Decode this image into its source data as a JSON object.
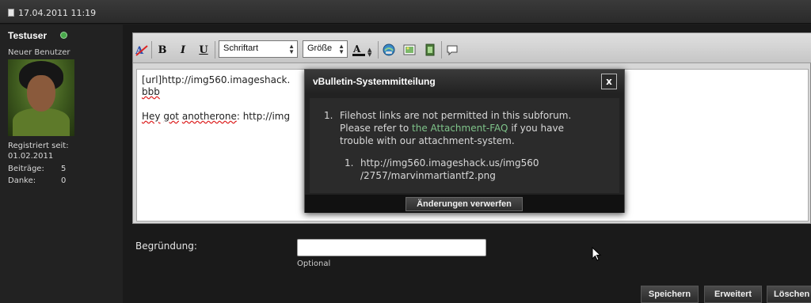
{
  "post": {
    "date": "17.04.2011 11:19"
  },
  "user": {
    "name": "Testuser",
    "title": "Neuer Benutzer",
    "registered_label": "Registriert seit:",
    "registered_date": "01.02.2011",
    "posts_label": "Beiträge:",
    "posts_value": "5",
    "thanks_label": "Danke:",
    "thanks_value": "0"
  },
  "toolbar": {
    "font_select": "Schriftart",
    "size_select": "Größe",
    "bold": "B",
    "italic": "I",
    "underline": "U"
  },
  "editor": {
    "line1": "[url]http://img560.imageshack.",
    "line2": "bbb",
    "line3_prefix": "Hey",
    "line3_word1": "got",
    "line3_word2": "anotherone",
    "line3_rest": ": http://img"
  },
  "modal": {
    "title": "vBulletin-Systemmitteilung",
    "close": "x",
    "item_number": "1.",
    "message_1": "Filehost links are not permitted in this subforum.",
    "message_2_before": "Please refer to",
    "message_2_link": "the Attachment-FAQ",
    "message_2_after": "if you have",
    "message_3": "trouble with our attachment-system.",
    "sub_number": "1.",
    "url_line1": "http://img560.imageshack.us/img560",
    "url_line2": "/2757/marvinmartiantf2.png",
    "discard_button": "Änderungen verwerfen"
  },
  "form": {
    "reason_label": "Begründung:",
    "reason_value": "",
    "reason_hint": "Optional",
    "save_button": "Speichern",
    "advanced_button": "Erweitert",
    "delete_button": "Löschen"
  },
  "colors": {
    "link": "#7fc48a",
    "online": "#48a84a"
  }
}
